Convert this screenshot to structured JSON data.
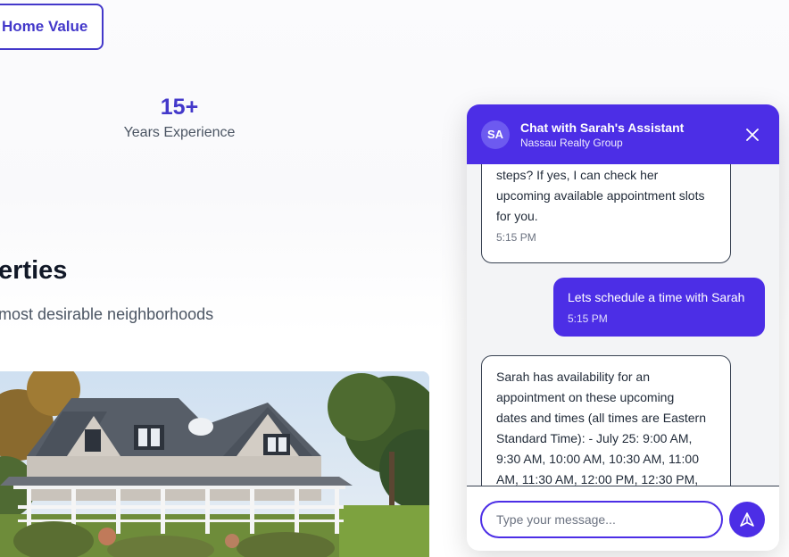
{
  "hero": {
    "home_value_label": "Home Value"
  },
  "stats": {
    "value": "15+",
    "label": "Years Experience"
  },
  "properties": {
    "title": "erties",
    "subtitle": "most desirable neighborhoods"
  },
  "chat": {
    "avatar_initials": "SA",
    "title": "Chat with Sarah's Assistant",
    "subtitle": "Nassau Realty Group",
    "messages": [
      {
        "sender": "bot",
        "lines": [
          "steps? If yes, I can check her",
          "upcoming available appointment slots",
          "for you."
        ],
        "time": "5:15 PM"
      },
      {
        "sender": "user",
        "text": "Lets schedule a time with Sarah",
        "time": "5:15 PM"
      },
      {
        "sender": "bot",
        "lines": [
          "Sarah has availability for an",
          "appointment on these upcoming",
          "dates and times (all times are Eastern",
          "Standard Time): - July 25: 9:00 AM,",
          "9:30 AM, 10:00 AM, 10:30 AM, 11:00",
          "AM, 11:30 AM, 12:00 PM, 12:30 PM,"
        ]
      }
    ],
    "input_placeholder": "Type your message...",
    "colors": {
      "accent": "#4c2ee6",
      "brand_text": "#4338ca"
    },
    "icons": {
      "close": "close-icon",
      "send": "send-icon"
    }
  }
}
